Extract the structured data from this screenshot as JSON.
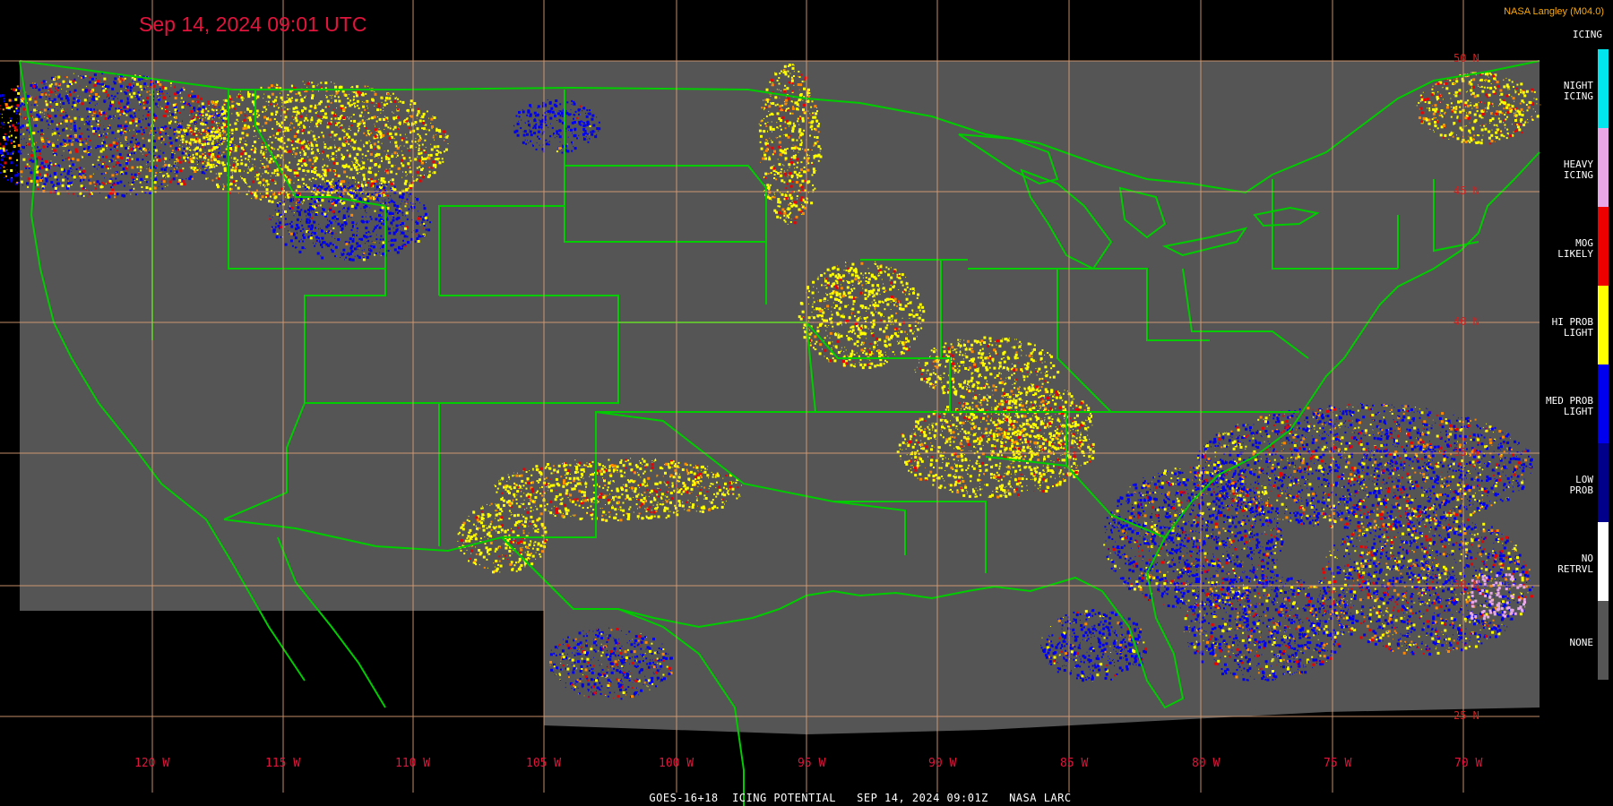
{
  "header": {
    "timestamp": "Sep 14, 2024 09:01 UTC",
    "producer": "NASA Langley (M04.0)"
  },
  "footer": {
    "caption": "GOES-16+18  ICING POTENTIAL   SEP 14, 2024 09:01Z   NASA LARC"
  },
  "legend": {
    "title": "ICING",
    "items": [
      {
        "label": "NIGHT\nICING",
        "color": "#00e5ee"
      },
      {
        "label": "HEAVY\nICING",
        "color": "#e8a8e8"
      },
      {
        "label": "MOG\nLIKELY",
        "color": "#ee0000"
      },
      {
        "label": "HI PROB\nLIGHT",
        "color": "#ffff00"
      },
      {
        "label": "MED PROB\nLIGHT",
        "color": "#0000ee"
      },
      {
        "label": "LOW\nPROB",
        "color": "#00008b"
      },
      {
        "label": "NO\nRETRVL",
        "color": "#ffffff"
      },
      {
        "label": "NONE",
        "color": "#555555"
      }
    ]
  },
  "axes": {
    "longitude_labels": [
      "120 W",
      "115 W",
      "110 W",
      "105 W",
      "100 W",
      "95 W",
      "90 W",
      "85 W",
      "80 W",
      "75 W",
      "70 W"
    ],
    "latitude_labels": [
      "50 N",
      "45 N",
      "40 N",
      "35 N",
      "30 N",
      "25 N"
    ]
  },
  "colors": {
    "background": "#000000",
    "no_data_area": "#555555",
    "borders": "#00cc00",
    "gridlines": "#e6a47a",
    "timestamp": "#e0143c"
  }
}
